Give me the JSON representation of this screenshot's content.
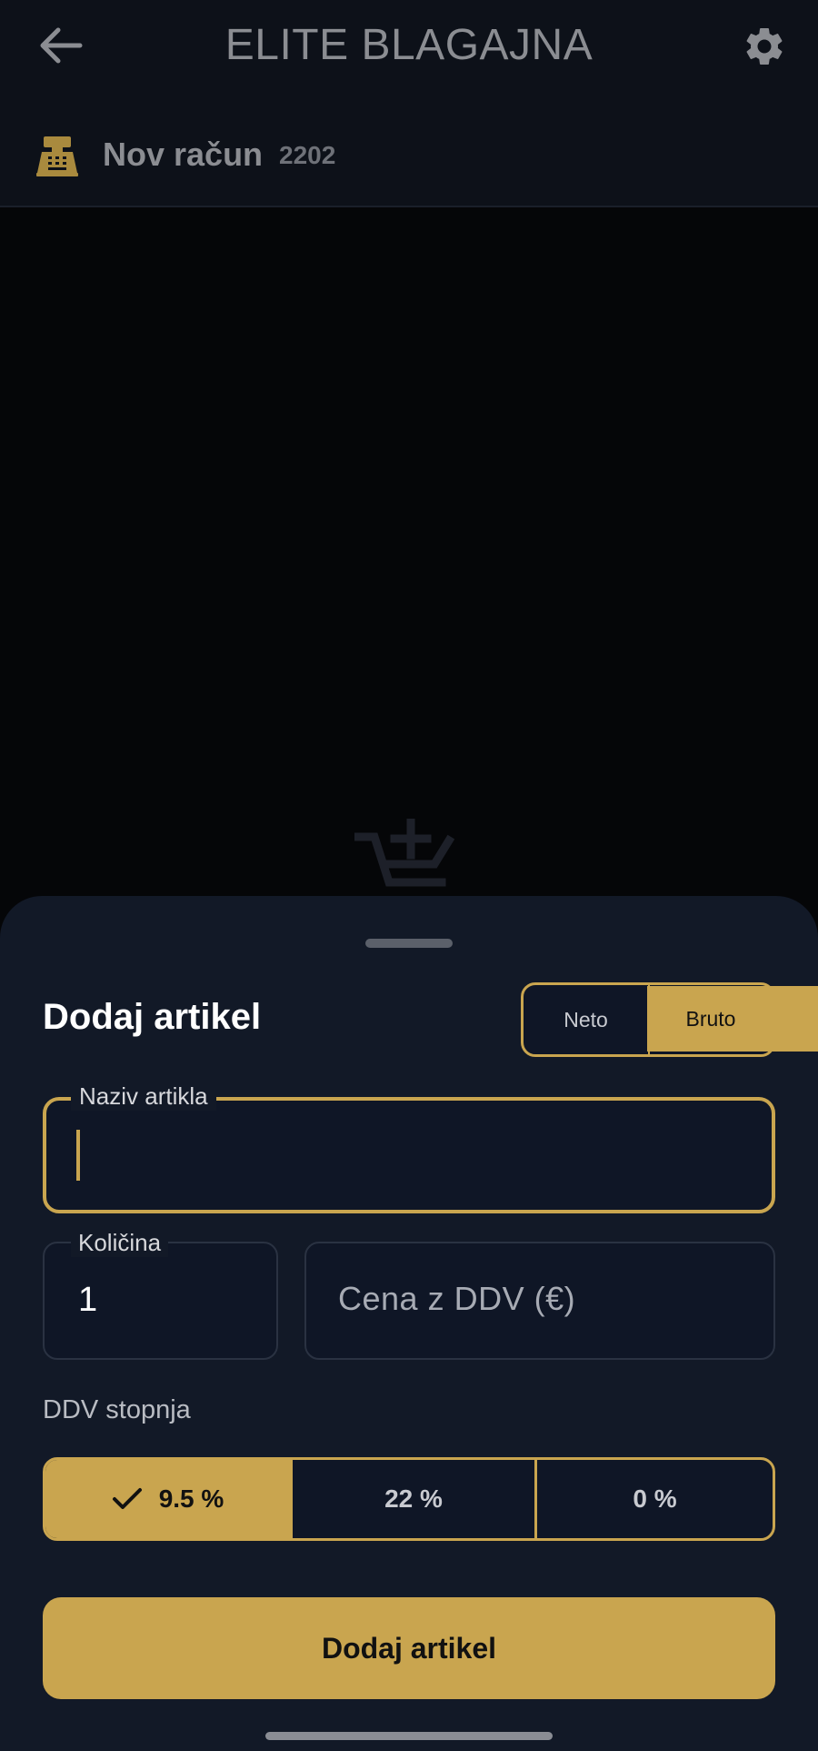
{
  "appbar": {
    "title": "ELITE BLAGAJNA"
  },
  "receipt": {
    "title": "Nov račun",
    "number": "2202"
  },
  "sheet": {
    "title": "Dodaj artikel",
    "price_mode": {
      "options": [
        "Neto",
        "Bruto"
      ],
      "selected": "Bruto"
    },
    "name_field": {
      "label": "Naziv artikla",
      "value": ""
    },
    "quantity_field": {
      "label": "Količina",
      "value": "1"
    },
    "price_field": {
      "placeholder": "Cena z DDV (€)"
    },
    "vat": {
      "label": "DDV stopnja",
      "options": [
        "9.5 %",
        "22 %",
        "0 %"
      ],
      "selected": "9.5 %"
    },
    "submit_label": "Dodaj artikel"
  },
  "colors": {
    "accent": "#c9a54f",
    "sheet_bg": "#121927",
    "appbar_bg": "#0d1119"
  },
  "icons": [
    "back-arrow-icon",
    "gear-icon",
    "cash-register-icon",
    "add-to-cart-icon",
    "check-icon"
  ]
}
